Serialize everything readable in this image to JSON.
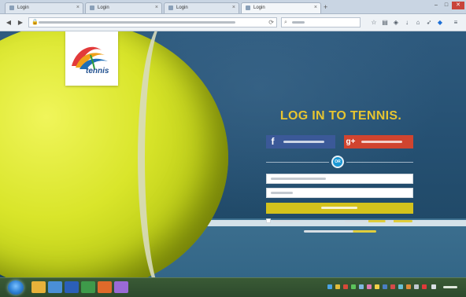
{
  "browser": {
    "tabs": [
      {
        "label": "Login",
        "active": false
      },
      {
        "label": "Login",
        "active": false
      },
      {
        "label": "Login",
        "active": false
      },
      {
        "label": "Login",
        "active": true
      }
    ],
    "new_tab_glyph": "+",
    "window_controls": {
      "minimize": "–",
      "maximize": "□",
      "close": "✕"
    },
    "toolbar_icons": [
      "back-icon",
      "forward-icon",
      "lock-icon",
      "reload-icon",
      "search-icon",
      "star-icon",
      "reading-list-icon",
      "pocket-icon",
      "download-icon",
      "home-icon",
      "send-icon",
      "shield-icon",
      "menu-icon"
    ]
  },
  "page": {
    "logo_text": "tennis",
    "heading": "LOG IN TO TENNIS.",
    "facebook_glyph": "f",
    "google_glyph": "g+",
    "or_label": "OR",
    "colors": {
      "heading": "#e7c530",
      "facebook": "#3b5998",
      "google": "#d0442f",
      "login_button": "#d3c21c",
      "or_badge": "#1a97d5",
      "accent_link": "#e0cd3c"
    }
  },
  "taskbar": {
    "start_icon": "windows-start-icon",
    "apps": [
      "explorer-icon",
      "media-icon",
      "word-icon",
      "excel-icon",
      "browser-icon",
      "paint-icon"
    ]
  }
}
